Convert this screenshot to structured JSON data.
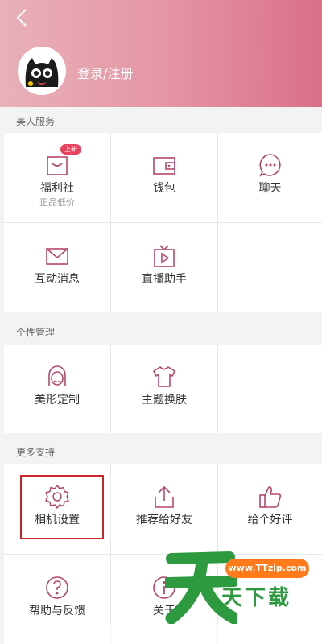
{
  "header": {
    "login_label": "登录/注册"
  },
  "sections": [
    {
      "title": "美人服务",
      "items": [
        {
          "label": "福利社",
          "sub": "正品低价",
          "icon": "gift-bag-icon",
          "badge": "上新"
        },
        {
          "label": "钱包",
          "icon": "wallet-icon"
        },
        {
          "label": "聊天",
          "icon": "chat-icon"
        },
        {
          "label": "互动消息",
          "icon": "envelope-icon"
        },
        {
          "label": "直播助手",
          "icon": "tv-play-icon"
        }
      ]
    },
    {
      "title": "个性管理",
      "items": [
        {
          "label": "美形定制",
          "icon": "face-icon"
        },
        {
          "label": "主题换肤",
          "icon": "tshirt-icon"
        }
      ]
    },
    {
      "title": "更多支持",
      "items": [
        {
          "label": "相机设置",
          "icon": "gear-icon"
        },
        {
          "label": "推荐给好友",
          "icon": "share-icon"
        },
        {
          "label": "给个好评",
          "icon": "thumbs-up-icon"
        },
        {
          "label": "帮助与反馈",
          "icon": "help-icon"
        },
        {
          "label": "关于",
          "icon": "info-icon"
        }
      ]
    }
  ],
  "watermark": {
    "url": "www.TTzip.com",
    "text": "天下载"
  },
  "colors": {
    "header_start": "#e9b1b9",
    "header_end": "#d9708a",
    "icon_stroke": "#b5476a",
    "badge": "#e8435f",
    "highlight_box": "#c8262a"
  }
}
